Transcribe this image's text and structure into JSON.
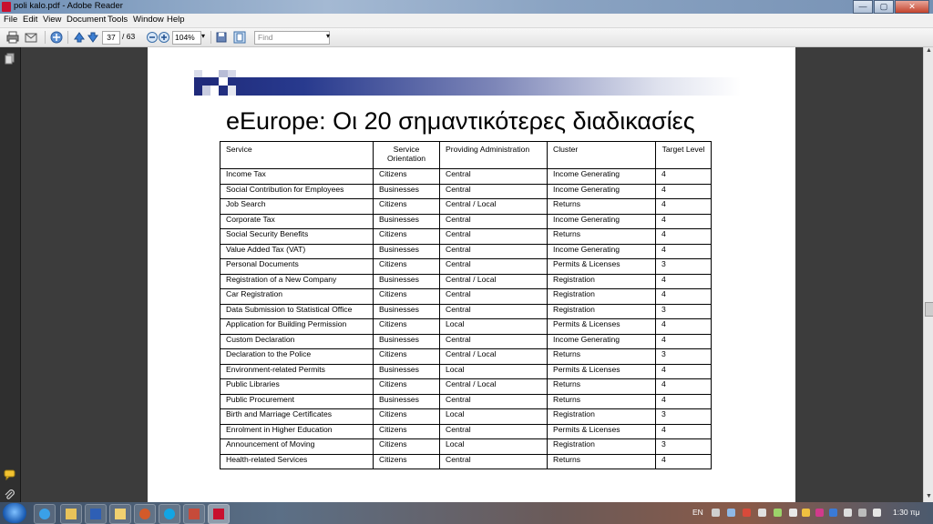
{
  "window": {
    "title": "poli kalo.pdf - Adobe Reader",
    "min": "—",
    "max": "▢",
    "close": "✕"
  },
  "menu": [
    "File",
    "Edit",
    "View",
    "Document",
    "Tools",
    "Window",
    "Help"
  ],
  "toolbar": {
    "page_current": "37",
    "page_total": "/ 63",
    "zoom": "104%",
    "find_placeholder": "Find"
  },
  "slide": {
    "title": "eEurope: Οι 20 σημαντικότερες διαδικασίες",
    "headers": [
      "Service",
      "Service Orientation",
      "Providing Administration",
      "Cluster",
      "Target Level"
    ],
    "rows": [
      [
        "Income Tax",
        "Citizens",
        "Central",
        "Income Generating",
        "4"
      ],
      [
        "Social Contribution for Employees",
        "Businesses",
        "Central",
        "Income Generating",
        "4"
      ],
      [
        "Job Search",
        "Citizens",
        "Central / Local",
        "Returns",
        "4"
      ],
      [
        "Corporate Tax",
        "Businesses",
        "Central",
        "Income Generating",
        "4"
      ],
      [
        "Social Security Benefits",
        "Citizens",
        "Central",
        "Returns",
        "4"
      ],
      [
        "Value Added Tax (VAT)",
        "Businesses",
        "Central",
        "Income Generating",
        "4"
      ],
      [
        "Personal Documents",
        "Citizens",
        "Central",
        "Permits & Licenses",
        "3"
      ],
      [
        "Registration of a New Company",
        "Businesses",
        "Central / Local",
        "Registration",
        "4"
      ],
      [
        "Car Registration",
        "Citizens",
        "Central",
        "Registration",
        "4"
      ],
      [
        "Data Submission to Statistical Office",
        "Businesses",
        "Central",
        "Registration",
        "3"
      ],
      [
        "Application for Building Permission",
        "Citizens",
        "Local",
        "Permits & Licenses",
        "4"
      ],
      [
        "Custom Declaration",
        "Businesses",
        "Central",
        "Income Generating",
        "4"
      ],
      [
        "Declaration to the Police",
        "Citizens",
        "Central / Local",
        "Returns",
        "3"
      ],
      [
        "Environment-related Permits",
        "Businesses",
        "Local",
        "Permits & Licenses",
        "4"
      ],
      [
        "Public Libraries",
        "Citizens",
        "Central / Local",
        "Returns",
        "4"
      ],
      [
        "Public Procurement",
        "Businesses",
        "Central",
        "Returns",
        "4"
      ],
      [
        "Birth and Marriage Certificates",
        "Citizens",
        "Local",
        "Registration",
        "3"
      ],
      [
        "Enrolment in Higher Education",
        "Citizens",
        "Central",
        "Permits & Licenses",
        "4"
      ],
      [
        "Announcement of Moving",
        "Citizens",
        "Local",
        "Registration",
        "3"
      ],
      [
        "Health-related Services",
        "Citizens",
        "Central",
        "Returns",
        "4"
      ]
    ]
  },
  "taskbar": {
    "language": "EN",
    "clock": "1:30 πμ"
  },
  "icons": [
    "app-icon",
    "print-icon",
    "email-icon",
    "collaborate-icon",
    "prev-page-icon",
    "next-page-icon",
    "zoom-out-icon",
    "zoom-in-icon",
    "save-icon",
    "fit-page-icon",
    "pages-panel-icon",
    "comments-icon",
    "attachments-icon",
    "start-icon"
  ],
  "colors": {
    "banner_dark": "#1f2a7a",
    "title_bar": "#7691b4",
    "close_button": "#c3422c"
  }
}
